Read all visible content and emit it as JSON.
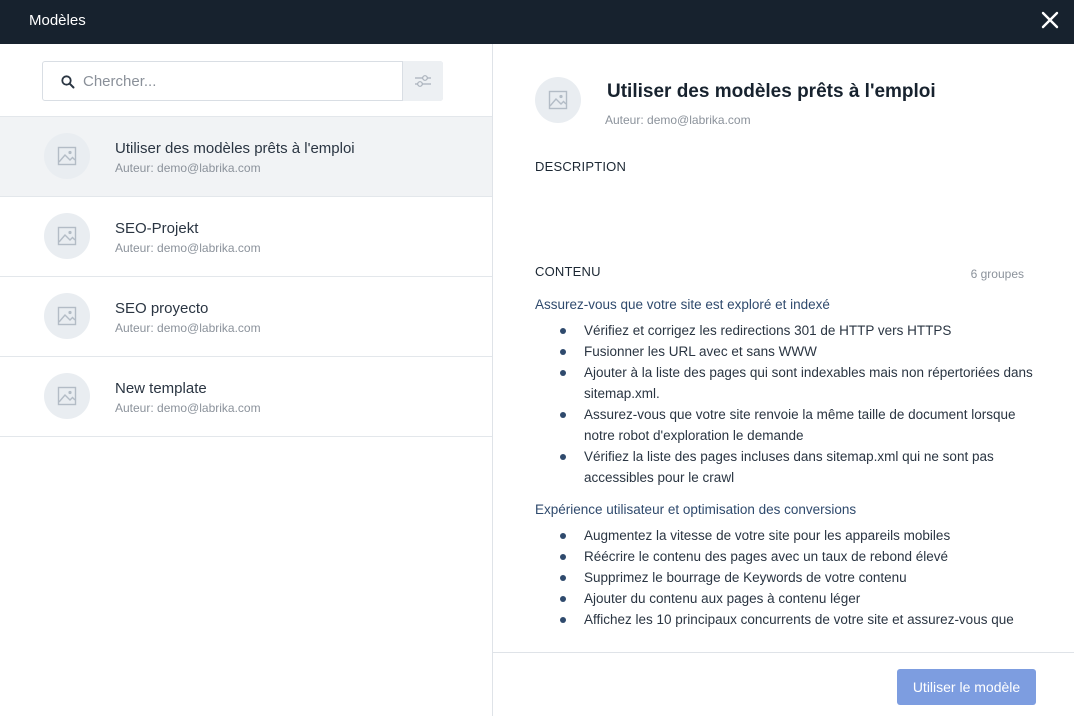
{
  "header": {
    "title": "Modèles",
    "close_icon": "close-icon"
  },
  "search": {
    "placeholder": "Chercher...",
    "value": ""
  },
  "templates": [
    {
      "title": "Utiliser des modèles prêts à l'emploi",
      "author": "Auteur: demo@labrika.com",
      "selected": true
    },
    {
      "title": "SEO-Projekt",
      "author": "Auteur: demo@labrika.com"
    },
    {
      "title": "SEO proyecto",
      "author": "Auteur: demo@labrika.com"
    },
    {
      "title": "New template",
      "author": "Auteur: demo@labrika.com"
    }
  ],
  "detail": {
    "title": "Utiliser des modèles prêts à l'emploi",
    "author": "Auteur: demo@labrika.com",
    "description_label": "DESCRIPTION",
    "content_label": "CONTENU",
    "groups_count": "6 groupes",
    "groups": [
      {
        "title": "Assurez-vous que votre site est exploré et indexé",
        "tasks": [
          "Vérifiez et corrigez les redirections 301 de HTTP vers HTTPS",
          "Fusionner les URL avec et sans WWW",
          "Ajouter à la liste des pages qui sont indexables mais non répertoriées dans sitemap.xml.",
          "Assurez-vous que votre site renvoie la même taille de document lorsque notre robot d'exploration le demande",
          "Vérifiez la liste des pages incluses dans sitemap.xml qui ne sont pas accessibles pour le crawl"
        ]
      },
      {
        "title": "Expérience utilisateur et optimisation des conversions",
        "tasks": [
          "Augmentez la vitesse de votre site pour les appareils mobiles",
          "Réécrire le contenu des pages avec un taux de rebond élevé",
          "Supprimez le bourrage de Keywords de votre contenu",
          "Ajouter du contenu aux pages à contenu léger",
          "Affichez les 10 principaux concurrents de votre site et assurez-vous que"
        ]
      }
    ],
    "use_button": "Utiliser le modèle"
  },
  "colors": {
    "header_bg": "#17222e",
    "accent_button": "#7d9de0",
    "group_title": "#2f4a6d",
    "selected_row": "#f1f3f5"
  }
}
